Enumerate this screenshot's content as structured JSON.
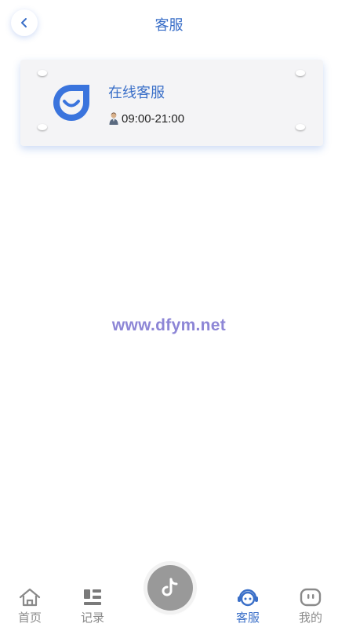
{
  "header": {
    "title": "客服",
    "back_icon": "chevron-left-icon"
  },
  "service": {
    "title": "在线客服",
    "hours": "09:00-21:00",
    "logo_icon": "smile-drop-logo-icon",
    "hours_icon": "person-icon"
  },
  "watermark": "www.dfym.net",
  "tabbar": {
    "items": [
      {
        "label": "首页",
        "icon": "home-icon"
      },
      {
        "label": "记录",
        "icon": "list-icon"
      },
      {
        "label": "客服",
        "icon": "headset-icon",
        "active": true
      },
      {
        "label": "我的",
        "icon": "profile-icon"
      }
    ],
    "center_icon": "tiktok-icon"
  },
  "colors": {
    "accent": "#3a6fc8",
    "inactive": "#8a8a8a",
    "center_button": "#999999"
  }
}
